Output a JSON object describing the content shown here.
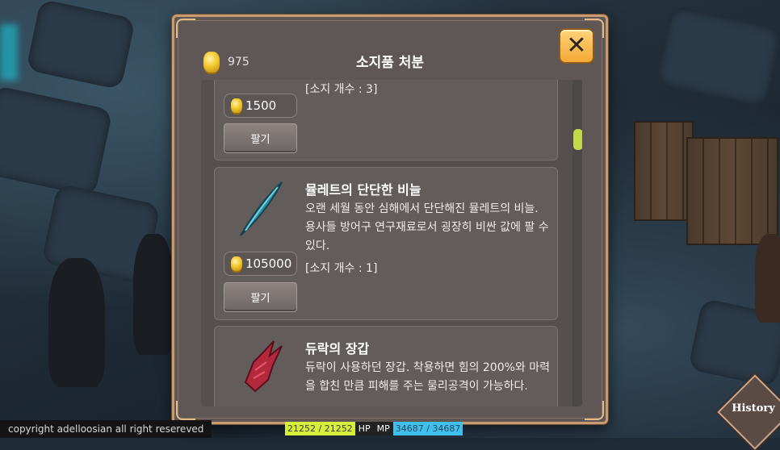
{
  "header": {
    "gold": "975",
    "title": "소지품 처분",
    "close_label": "✕"
  },
  "items": [
    {
      "price": "1500",
      "sell_label": "팔기",
      "owned": "[소지 개수 : 3]"
    },
    {
      "name": "뮬레트의 단단한 비늘",
      "desc": "오랜 세월 동안 심해에서 단단해진 뮬레트의 비늘. 용사들 방어구 연구재료로서 굉장히 비싼 값에 팔 수 있다.",
      "price": "105000",
      "sell_label": "팔기",
      "owned": "[소지 개수 : 1]"
    },
    {
      "name": "듀락의 장갑",
      "desc": "듀락이 사용하던 장갑. 착용하면 힘의 200%와 마력을 합친 만큼 피해를 주는 물리공격이 가능하다."
    }
  ],
  "footer": {
    "copyright": "copyright adelloosian all right resereved",
    "hp_value": "21252 / 21252",
    "hp_label": "HP",
    "mp_label": "MP",
    "mp_value": "34687 / 34687",
    "history_label": "History"
  },
  "colors": {
    "gold": "#f3c62c",
    "frame": "#c99a6e",
    "hp": "#d6ef3a",
    "mp": "#3fc1f0",
    "scroll_thumb": "#c4d94a"
  }
}
